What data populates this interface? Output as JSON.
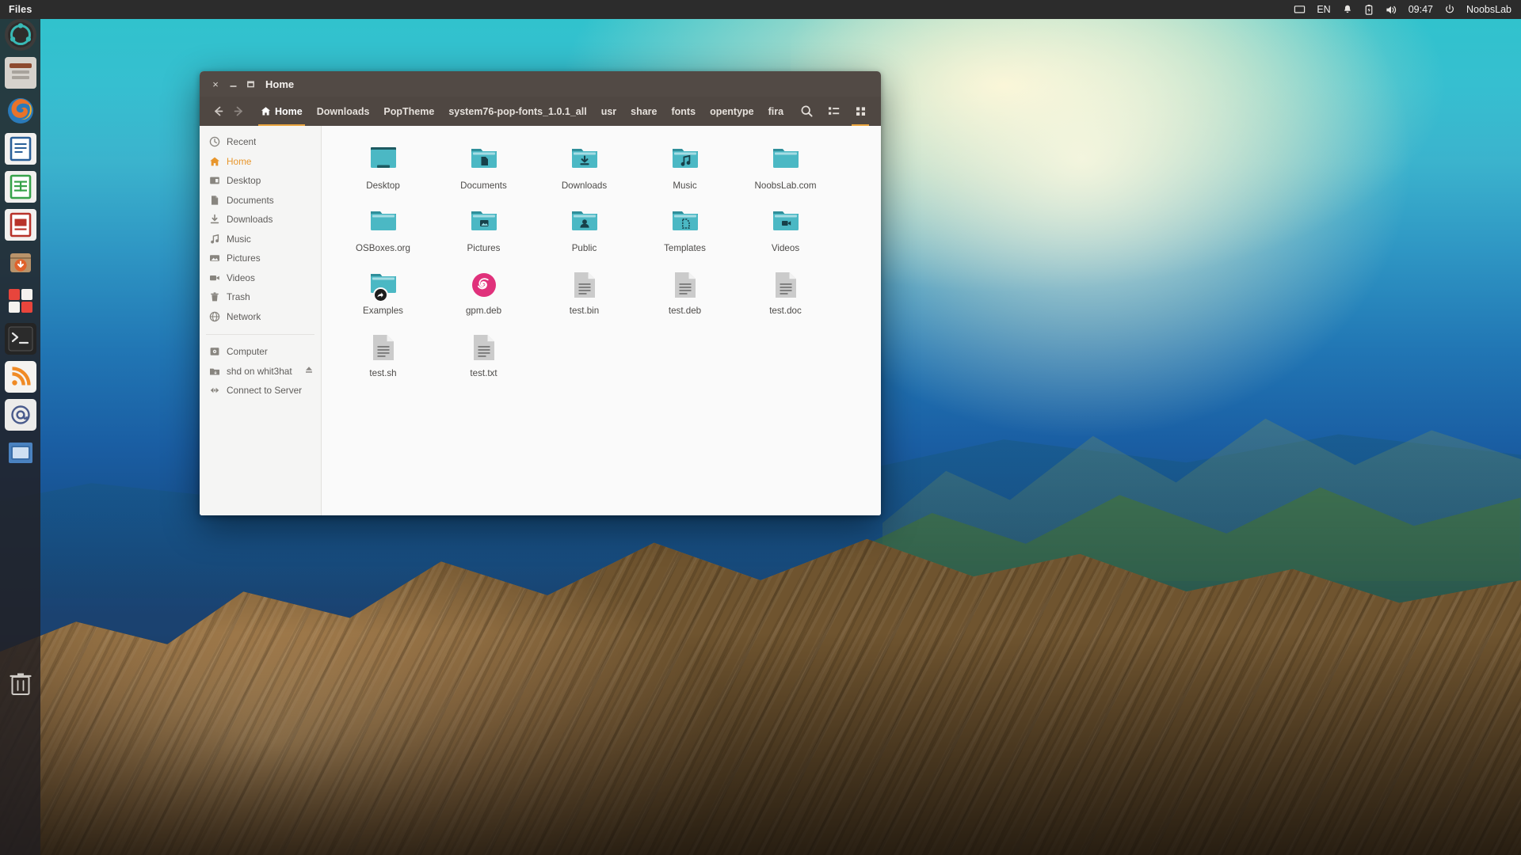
{
  "panel": {
    "app_name": "Files",
    "indicators": [
      {
        "name": "display-icon",
        "glyph": "display"
      },
      {
        "name": "keyboard-layout-indicator",
        "glyph": "EN"
      },
      {
        "name": "notifications-icon",
        "glyph": "bell"
      },
      {
        "name": "battery-icon",
        "glyph": "battery"
      },
      {
        "name": "volume-icon",
        "glyph": "speaker"
      }
    ],
    "clock": "09:47",
    "user": "NoobsLab",
    "power_icon": "power-icon"
  },
  "launcher": {
    "items": [
      {
        "name": "ubuntu-dash-icon",
        "label": "Dash",
        "color": "#3d3b3a"
      },
      {
        "name": "files-icon",
        "label": "Files",
        "color": "#d8d4cf"
      },
      {
        "name": "firefox-icon",
        "label": "Firefox",
        "color": "#e8732a"
      },
      {
        "name": "libreoffice-writer-icon",
        "label": "LibreOffice Writer",
        "color": "#2a6099"
      },
      {
        "name": "libreoffice-calc-icon",
        "label": "LibreOffice Calc",
        "color": "#37a24a"
      },
      {
        "name": "libreoffice-impress-icon",
        "label": "LibreOffice Impress",
        "color": "#b8332a"
      },
      {
        "name": "ubuntu-software-icon",
        "label": "Ubuntu Software",
        "color": "#d9663f"
      },
      {
        "name": "system-settings-icon",
        "label": "System Settings",
        "color": "#e8453c"
      },
      {
        "name": "terminal-icon",
        "label": "Terminal",
        "color": "#2b2b2b"
      },
      {
        "name": "rss-reader-icon",
        "label": "RSS Reader",
        "color": "#f08a24"
      },
      {
        "name": "email-icon",
        "label": "Email",
        "color": "#4a5b8c"
      },
      {
        "name": "workspace-switcher-icon",
        "label": "Workspace Switcher",
        "color": "#3a6ea8"
      },
      {
        "name": "trash-icon",
        "label": "Trash",
        "color": "#b9b5b0"
      }
    ]
  },
  "window": {
    "title": "Home",
    "controls": {
      "close": "×",
      "minimize": "–",
      "maximize": "❐"
    },
    "nav": {
      "back": "back-arrow",
      "forward": "forward-arrow"
    },
    "breadcrumbs": [
      {
        "label": "Home",
        "icon": "home-icon",
        "active": true
      },
      {
        "label": "Downloads",
        "icon": "",
        "active": false
      },
      {
        "label": "PopTheme",
        "icon": "",
        "active": false
      },
      {
        "label": "system76-pop-fonts_1.0.1_all",
        "icon": "",
        "active": false
      },
      {
        "label": "usr",
        "icon": "",
        "active": false
      },
      {
        "label": "share",
        "icon": "",
        "active": false
      },
      {
        "label": "fonts",
        "icon": "",
        "active": false
      },
      {
        "label": "opentype",
        "icon": "",
        "active": false
      },
      {
        "label": "fira",
        "icon": "",
        "active": false
      }
    ],
    "actions": [
      {
        "name": "search-button",
        "icon": "search-icon",
        "selected": false
      },
      {
        "name": "list-view-button",
        "icon": "list-view-icon",
        "selected": false
      },
      {
        "name": "grid-view-button",
        "icon": "grid-view-icon",
        "selected": true
      }
    ],
    "accent_color": "#e8a33d",
    "titlebar_color": "#524a45"
  },
  "sidebar": {
    "group1": [
      {
        "label": "Recent",
        "icon": "clock-icon",
        "active": false
      },
      {
        "label": "Home",
        "icon": "home-icon",
        "active": true
      },
      {
        "label": "Desktop",
        "icon": "desktop-icon",
        "active": false
      },
      {
        "label": "Documents",
        "icon": "document-icon",
        "active": false
      },
      {
        "label": "Downloads",
        "icon": "download-icon",
        "active": false
      },
      {
        "label": "Music",
        "icon": "music-note-icon",
        "active": false
      },
      {
        "label": "Pictures",
        "icon": "image-icon",
        "active": false
      },
      {
        "label": "Videos",
        "icon": "video-camera-icon",
        "active": false
      },
      {
        "label": "Trash",
        "icon": "trash-icon",
        "active": false
      },
      {
        "label": "Network",
        "icon": "globe-icon",
        "active": false
      }
    ],
    "group2": [
      {
        "label": "Computer",
        "icon": "computer-icon",
        "active": false,
        "eject": false
      },
      {
        "label": "shd on whit3hat",
        "icon": "network-drive-icon",
        "active": false,
        "eject": true
      },
      {
        "label": "Connect to Server",
        "icon": "connect-server-icon",
        "active": false,
        "eject": false
      }
    ]
  },
  "files": [
    {
      "name": "Desktop",
      "type": "folder-desktop"
    },
    {
      "name": "Documents",
      "type": "folder-documents"
    },
    {
      "name": "Downloads",
      "type": "folder-downloads"
    },
    {
      "name": "Music",
      "type": "folder-music"
    },
    {
      "name": "NoobsLab.com",
      "type": "folder-plain"
    },
    {
      "name": "OSBoxes.org",
      "type": "folder-plain"
    },
    {
      "name": "Pictures",
      "type": "folder-pictures"
    },
    {
      "name": "Public",
      "type": "folder-public"
    },
    {
      "name": "Templates",
      "type": "folder-templates"
    },
    {
      "name": "Videos",
      "type": "folder-videos"
    },
    {
      "name": "Examples",
      "type": "folder-symlink"
    },
    {
      "name": "gpm.deb",
      "type": "file-deb"
    },
    {
      "name": "test.bin",
      "type": "file-text"
    },
    {
      "name": "test.deb",
      "type": "file-text"
    },
    {
      "name": "test.doc",
      "type": "file-text"
    },
    {
      "name": "test.sh",
      "type": "file-text"
    },
    {
      "name": "test.txt",
      "type": "file-text"
    }
  ],
  "colors": {
    "folder_teal": "#4bb8c4",
    "folder_teal_dark": "#2f8f9b",
    "folder_tab": "#3aa6b4",
    "deb_pink": "#e0317b",
    "file_grey": "#c9c9c9",
    "accent_orange": "#e8962c"
  }
}
